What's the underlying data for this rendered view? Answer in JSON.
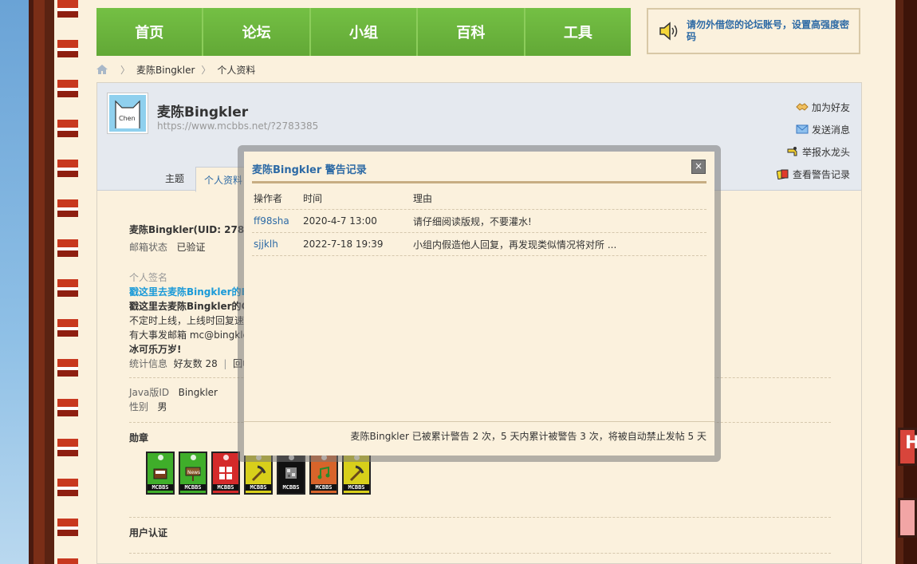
{
  "nav": {
    "items": [
      "首页",
      "论坛",
      "小组",
      "百科",
      "工具"
    ]
  },
  "notice": {
    "text": "请勿外借您的论坛账号，设置高强度密码"
  },
  "breadcrumb": {
    "user": "麦陈Bingkler",
    "page": "个人资料"
  },
  "profile": {
    "name": "麦陈Bingkler",
    "url": "https://www.mcbbs.net/?2783385",
    "avatar_text": "Chen",
    "actions": [
      "加为好友",
      "发送消息",
      "举报水龙头",
      "查看警告记录"
    ],
    "tabs": [
      "主题",
      "个人资料"
    ]
  },
  "details": {
    "uid_line": "麦陈Bingkler(UID: 27833",
    "email_label": "邮箱状态",
    "email_value": "已验证",
    "sig_label": "个人签名",
    "sig_link": "戳这里去麦陈Bingkler的B",
    "sig_bold": "戳这里去麦陈Bingkler的Gi",
    "sig_line3": "不定时上线，上线时回复速",
    "sig_line4": "有大事发邮箱 mc@bingkler",
    "sig_line5": "冰可乐万岁!",
    "stats_label": "统计信息",
    "stats_friends": "好友数 28",
    "stats_more": "回帖",
    "java_label": "Java版ID",
    "java_value": "Bingkler",
    "gender_label": "性别",
    "gender_value": "男",
    "medals_label": "勋章",
    "auth_label": "用户认证"
  },
  "medals": [
    {
      "color": "#3fae2a",
      "icon": "book-icon"
    },
    {
      "color": "#3fae2a",
      "icon": "news-sign-icon"
    },
    {
      "color": "#d42a2a",
      "icon": "window-icon"
    },
    {
      "color": "#d8cf1a",
      "icon": "pickaxe-icon"
    },
    {
      "color": "#111111",
      "icon": "ore-icon"
    },
    {
      "color": "#d8642a",
      "icon": "music-icon"
    },
    {
      "color": "#d8cf1a",
      "icon": "pickaxe-icon"
    }
  ],
  "dialog": {
    "title": "麦陈Bingkler 警告记录",
    "close": "×",
    "headers": [
      "操作者",
      "时间",
      "理由"
    ],
    "rows": [
      {
        "operator": "ff98sha",
        "time": "2020-4-7 13:00",
        "reason": "请仔细阅读版规，不要灌水!"
      },
      {
        "operator": "sjjklh",
        "time": "2022-7-18 19:39",
        "reason": "小组内假造他人回复，再发现类似情况将对所 ..."
      }
    ],
    "footer": "麦陈Bingkler 已被累计警告 2 次，5 天内累计被警告 3 次，将被自动禁止发帖 5 天"
  }
}
